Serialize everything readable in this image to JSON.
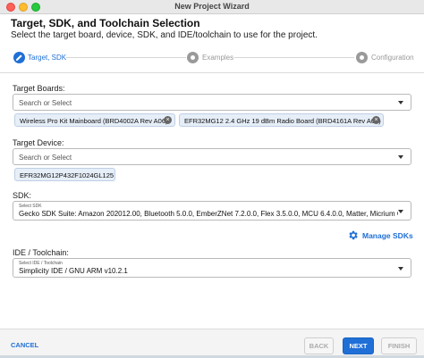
{
  "window": {
    "title": "New Project Wizard"
  },
  "header": {
    "title": "Target, SDK, and Toolchain Selection",
    "subtitle": "Select the target board, device, SDK, and IDE/toolchain to use for the project."
  },
  "steps": [
    {
      "label": "Target, SDK",
      "state": "active"
    },
    {
      "label": "Examples",
      "state": "inactive"
    },
    {
      "label": "Configuration",
      "state": "inactive"
    }
  ],
  "target_boards": {
    "label": "Target Boards:",
    "placeholder": "Search or Select",
    "chips": [
      "Wireless Pro Kit Mainboard (BRD4002A Rev A06)",
      "EFR32MG12 2.4 GHz 19 dBm Radio Board (BRD4161A Rev A02)"
    ]
  },
  "target_device": {
    "label": "Target Device:",
    "placeholder": "Search or Select",
    "chips": [
      "EFR32MG12P432F1024GL125"
    ]
  },
  "sdk": {
    "label": "SDK:",
    "small_label": "Select SDK",
    "value": "Gecko SDK Suite: Amazon 202012.00, Bluetooth 5.0.0, EmberZNet 7.2.0.0, Flex 3.5.0.0, MCU 6.4.0.0, Matter, Micrium OS Kerne"
  },
  "manage_sdks": {
    "label": "Manage SDKs",
    "icon": "gear-icon"
  },
  "toolchain": {
    "label": "IDE / Toolchain:",
    "small_label": "Select IDE / Toolchain",
    "value": "Simplicity IDE / GNU ARM v10.2.1"
  },
  "footer": {
    "cancel": "CANCEL",
    "back": "BACK",
    "next": "NEXT",
    "finish": "FINISH"
  },
  "colors": {
    "accent": "#1f6fd6",
    "chip_bg": "#e6eef8"
  }
}
